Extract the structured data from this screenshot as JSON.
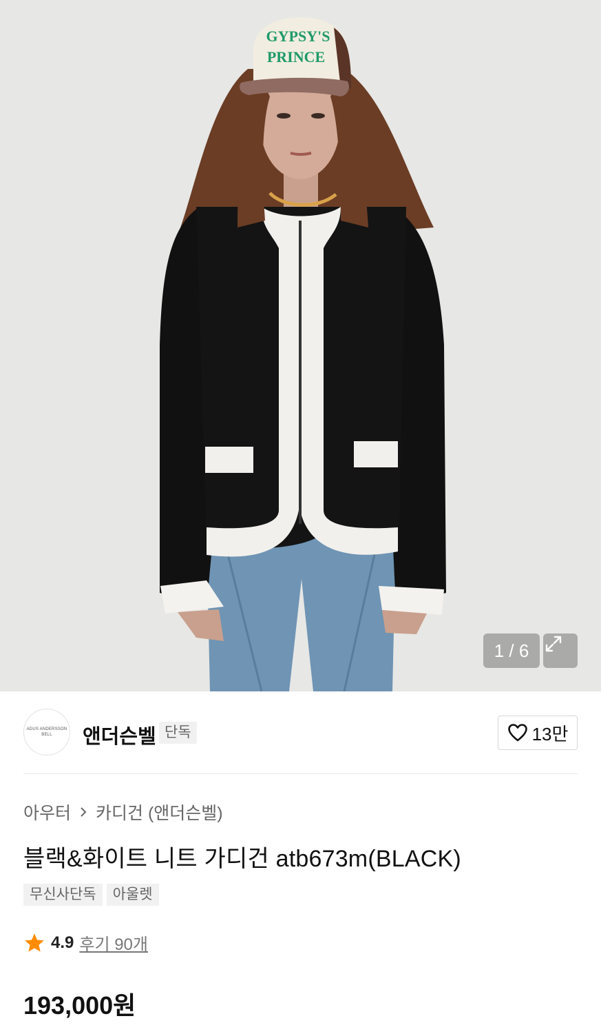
{
  "gallery": {
    "counter": "1 / 6",
    "cap_text_line1": "GYPSY'S",
    "cap_text_line2": "PRINCE",
    "expand_icon": "expand-icon"
  },
  "brand": {
    "logo_text": "ADUS ANDERSSON BELL",
    "name": "앤더슨벨",
    "badge": "단독",
    "like_icon": "heart-icon",
    "like_count": "13만"
  },
  "breadcrumb": {
    "category": "아우터",
    "separator_icon": "chevron-right-icon",
    "subcategory": "카디건 (앤더슨벨)"
  },
  "product": {
    "title": "블랙&화이트 니트 가디건 atb673m(BLACK)",
    "tags": [
      "무신사단독",
      "아울렛"
    ],
    "rating_icon": "star-icon",
    "rating": "4.9",
    "reviews": "후기 90개",
    "price": "193,000원"
  },
  "colors": {
    "star": "#ff8c00",
    "hero_bg": "#e6e6e4",
    "cap_text": "#1f9a6a"
  }
}
